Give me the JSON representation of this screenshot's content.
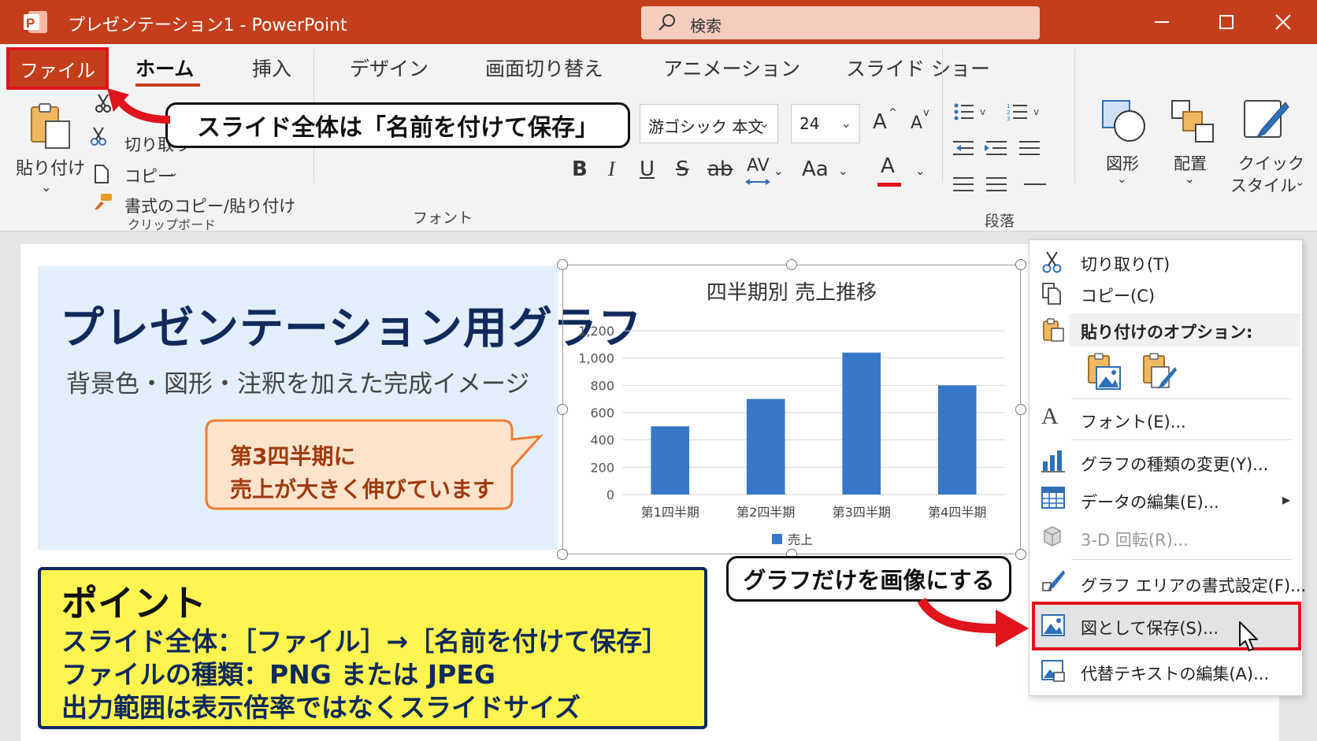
{
  "titlebar": {
    "app_title": "プレゼンテーション1 - PowerPoint",
    "search_placeholder": "検索",
    "brand_color": "#c43e1c"
  },
  "tabs": [
    "ファイル",
    "ホーム",
    "挿入",
    "デザイン",
    "画面切り替え",
    "アニメーション",
    "スライド ショー"
  ],
  "ribbon": {
    "clipboard": {
      "paste_label": "貼り付け",
      "cut_label": "切り取り",
      "copy_label": "コピー",
      "format_painter_label": "書式のコピー/貼り付け",
      "group_label": "クリップボード"
    },
    "font": {
      "font_name": "游ゴシック 本文",
      "font_size": "24",
      "grow_label": "A",
      "shrink_label": "A",
      "bold": "B",
      "italic": "I",
      "underline": "U",
      "strike": "S",
      "strike_ab": "ab",
      "spacing": "AV",
      "case": "Aa",
      "color_label": "A",
      "group_label": "フォント"
    },
    "paragraph": {
      "group_label": "段落"
    },
    "drawing": {
      "shapes_label": "図形",
      "arrange_label": "配置",
      "quick_styles_line1": "クイック",
      "quick_styles_line2": "スタイル"
    }
  },
  "callouts": {
    "save_slide": "スライド全体は「名前を付けて保存」",
    "chart_only": "グラフだけを画像にする"
  },
  "slide": {
    "title": "プレゼンテーション用グラフ",
    "subtitle": "背景色・図形・注釈を加えた完成イメージ",
    "bubble_line1": "第3四半期に",
    "bubble_line2": "売上が大きく伸びています",
    "point_title": "ポイント",
    "point_lines": [
      "スライド全体：［ファイル］→［名前を付けて保存］",
      "ファイルの種類：PNG または JPEG",
      "出力範囲は表示倍率ではなくスライドサイズ"
    ]
  },
  "chart_data": {
    "type": "bar",
    "title": "四半期別 売上推移",
    "categories": [
      "第1四半期",
      "第2四半期",
      "第3四半期",
      "第4四半期"
    ],
    "series": [
      {
        "name": "売上",
        "values": [
          500,
          700,
          1040,
          800
        ]
      }
    ],
    "ylim": [
      0,
      1200
    ],
    "yticks": [
      "0",
      "200",
      "400",
      "600",
      "800",
      "1,000",
      "1,200"
    ],
    "grid": true,
    "legend": "bottom",
    "bar_color": "#3777c8"
  },
  "context_menu": {
    "items": [
      {
        "label": "切り取り(T)",
        "icon": "scissors-icon"
      },
      {
        "label": "コピー(C)",
        "icon": "copy-icon"
      },
      {
        "label": "貼り付けのオプション:",
        "icon": "paste-icon"
      },
      {
        "label": "フォント(E)...",
        "icon": "font-icon"
      },
      {
        "label": "グラフの種類の変更(Y)...",
        "icon": "chart-type-icon"
      },
      {
        "label": "データの編集(E)...",
        "icon": "data-table-icon"
      },
      {
        "label": "3-D 回転(R)...",
        "icon": "3d-rotation-icon"
      },
      {
        "label": "グラフ エリアの書式設定(F)...",
        "icon": "format-brush-icon"
      },
      {
        "label": "図として保存(S)...",
        "icon": "picture-icon"
      },
      {
        "label": "代替テキストの編集(A)...",
        "icon": "alt-text-icon"
      }
    ]
  },
  "highlight_color": "#e0141c"
}
